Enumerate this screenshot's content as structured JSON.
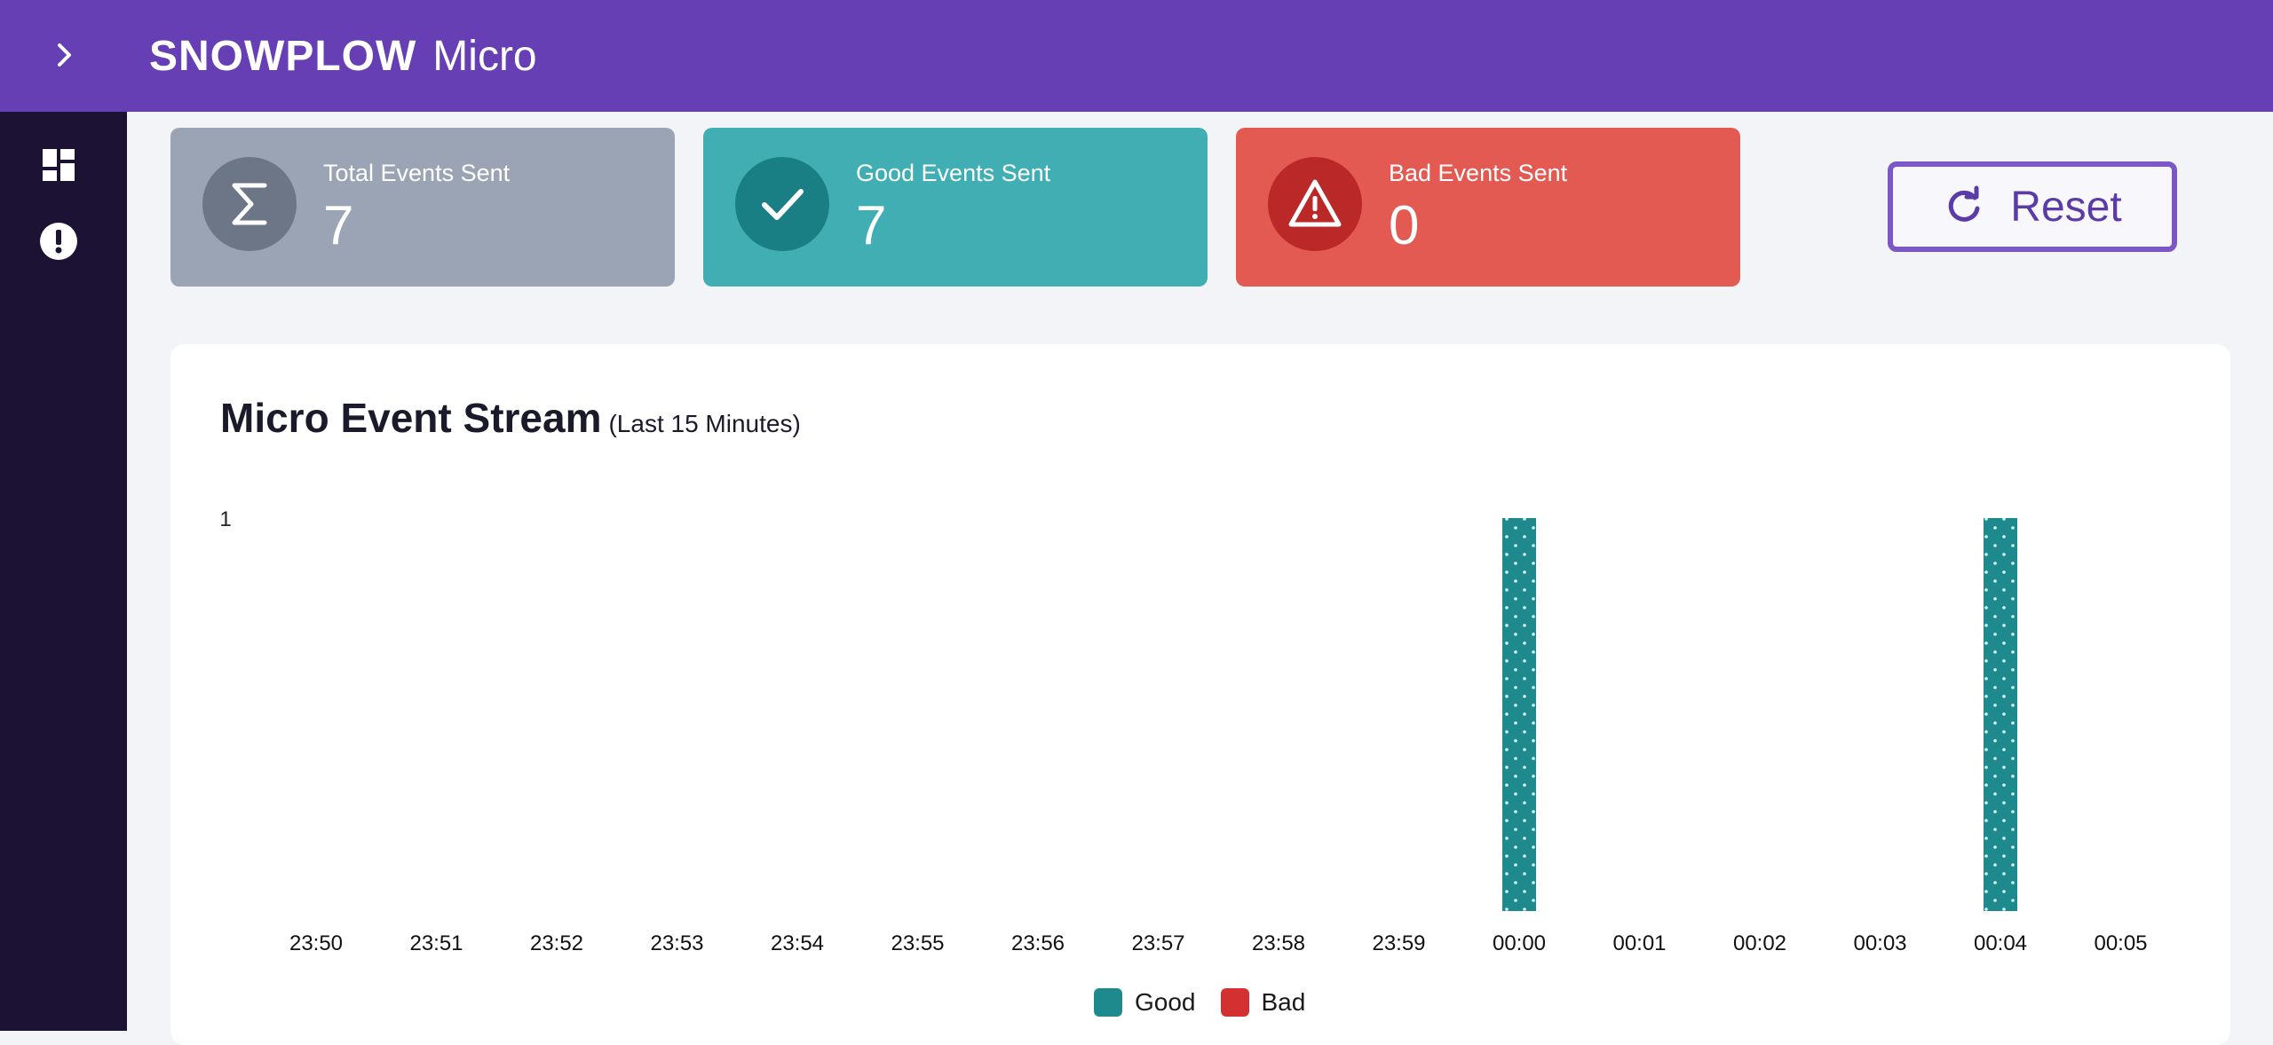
{
  "header": {
    "brand_main": "SNOWPLOW",
    "brand_sub": "Micro",
    "expand_icon": "chevron-right-icon",
    "background_color": "#673fb5"
  },
  "sidebar": {
    "items": [
      {
        "icon": "dashboard-icon"
      },
      {
        "icon": "alert-circle-icon"
      }
    ]
  },
  "stats": {
    "total": {
      "label": "Total Events Sent",
      "value": "7",
      "icon": "sigma-icon",
      "color": "#9aa4b4"
    },
    "good": {
      "label": "Good Events Sent",
      "value": "7",
      "icon": "check-icon",
      "color": "#40aeb3"
    },
    "bad": {
      "label": "Bad Events Sent",
      "value": "0",
      "icon": "warning-icon",
      "color": "#e35a52"
    }
  },
  "reset": {
    "label": "Reset",
    "icon": "refresh-icon"
  },
  "chart": {
    "title": "Micro Event Stream",
    "subtitle": "(Last 15 Minutes)"
  },
  "chart_data": {
    "type": "bar",
    "title": "Micro Event Stream",
    "subtitle": "(Last 15 Minutes)",
    "categories": [
      "23:50",
      "23:51",
      "23:52",
      "23:53",
      "23:54",
      "23:55",
      "23:56",
      "23:57",
      "23:58",
      "23:59",
      "00:00",
      "00:01",
      "00:02",
      "00:03",
      "00:04",
      "00:05"
    ],
    "series": [
      {
        "name": "Good",
        "color": "#1e8a8e",
        "values": [
          0,
          0,
          0,
          0,
          0,
          0,
          0,
          0,
          0,
          0,
          1,
          0,
          0,
          0,
          1,
          0
        ]
      },
      {
        "name": "Bad",
        "color": "#d33131",
        "values": [
          0,
          0,
          0,
          0,
          0,
          0,
          0,
          0,
          0,
          0,
          0,
          0,
          0,
          0,
          0,
          0
        ]
      }
    ],
    "ylim": [
      0,
      1
    ],
    "yticks": [
      "1"
    ],
    "grid": false,
    "legend": "bottom-center"
  }
}
